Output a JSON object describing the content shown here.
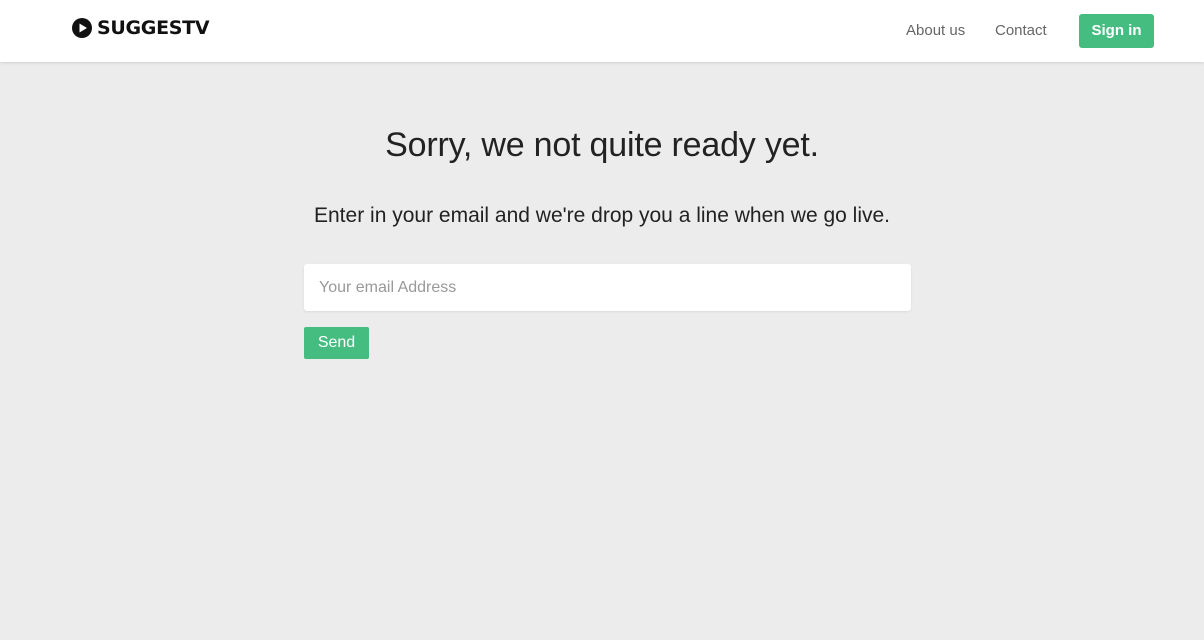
{
  "header": {
    "brand": "SUGGESTV",
    "brand_icon": "play-circle-icon",
    "nav": {
      "about_label": "About us",
      "contact_label": "Contact"
    },
    "signin_label": "Sign in"
  },
  "main": {
    "headline": "Sorry, we not quite ready yet.",
    "subline": "Enter in your email and we're drop you a line when we go live.",
    "email": {
      "value": "",
      "placeholder": "Your email Address"
    },
    "send_label": "Send"
  },
  "colors": {
    "accent": "#45bd80",
    "background": "#ececec",
    "header_bg": "#ffffff"
  }
}
